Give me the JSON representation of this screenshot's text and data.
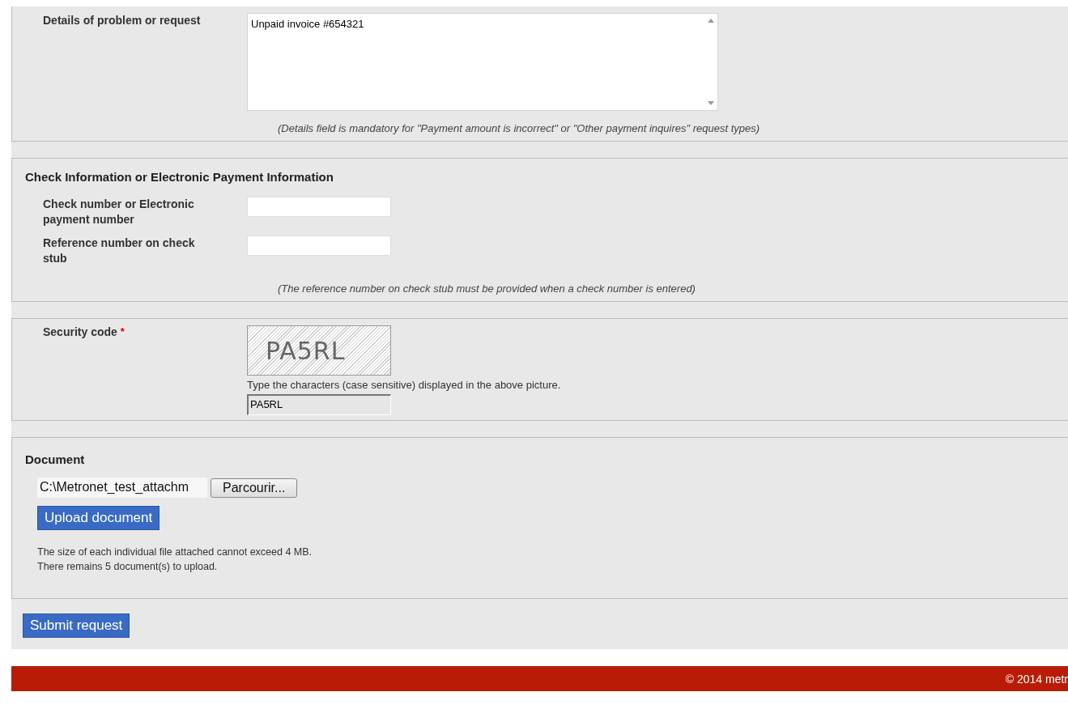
{
  "details": {
    "label": "Details of problem or request",
    "value": "Unpaid invoice #654321",
    "hint": "(Details field is mandatory for \"Payment amount is incorrect\" or \"Other payment inquires\" request types)"
  },
  "check_info": {
    "title": "Check Information or Electronic Payment Information",
    "fields": [
      {
        "label": "Check number or Electronic payment number"
      },
      {
        "label": "Reference number on check stub"
      }
    ],
    "hint": "(The reference number on check stub must be provided when a check number is entered)"
  },
  "security": {
    "label": "Security code",
    "required_mark": "*",
    "captcha_text": "PA5RL",
    "instruction": "Type the characters (case sensitive) displayed in the above picture.",
    "value": "PA5RL"
  },
  "document": {
    "title": "Document",
    "file_value": "C:\\Metronet_test_attachm",
    "browse_button": "Parcourir...",
    "upload_button": "Upload document",
    "notes": [
      "The size of each individual file attached cannot exceed 4 MB.",
      "There remains 5 document(s) to upload."
    ]
  },
  "submit_button": "Submit request",
  "footer": {
    "text": "© 2014 metr"
  }
}
